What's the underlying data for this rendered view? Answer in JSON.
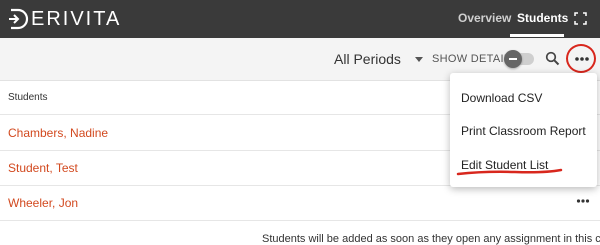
{
  "app": {
    "brand": "ERIVITA",
    "nav": {
      "overview": "Overview",
      "students": "Students"
    }
  },
  "toolbar": {
    "period": "All Periods",
    "show_details": "SHOW DETAILS"
  },
  "table": {
    "header": "Students",
    "rows": [
      {
        "name": "Chambers, Nadine"
      },
      {
        "name": "Student, Test"
      },
      {
        "name": "Wheeler, Jon"
      }
    ],
    "footer": "Students will be added as soon as they open any assignment in this course"
  },
  "menu": {
    "items": [
      "Download CSV",
      "Print Classroom Report",
      "Edit Student List"
    ]
  },
  "colors": {
    "topbar": "#3a3a3a",
    "accent_link": "#d2491f",
    "annotation_red": "#d8271d"
  },
  "icons": [
    "derivita-logo-icon",
    "fullscreen-icon",
    "caret-down-icon",
    "search-icon",
    "more-icon"
  ]
}
